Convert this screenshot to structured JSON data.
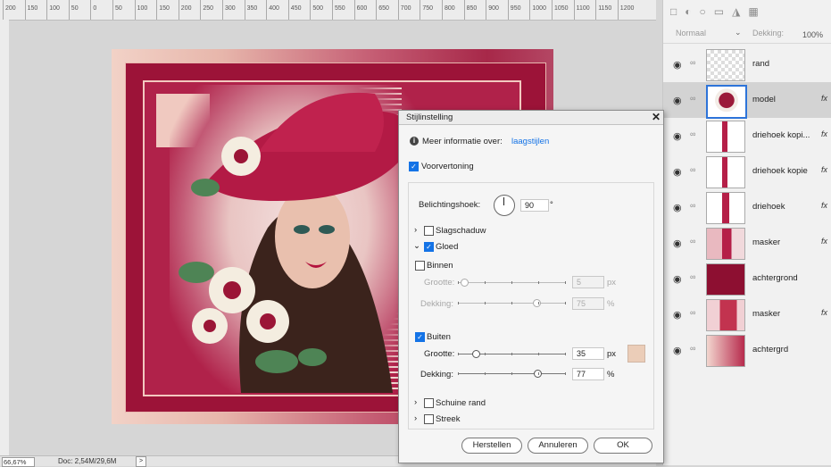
{
  "ruler": {
    "ticks": [
      "200",
      "150",
      "100",
      "50",
      "0",
      "50",
      "100",
      "150",
      "200",
      "250",
      "300",
      "350",
      "400",
      "450",
      "500",
      "550",
      "600",
      "650",
      "700",
      "750",
      "800",
      "850",
      "900",
      "950",
      "1000",
      "1050",
      "1100",
      "1150",
      "1200"
    ]
  },
  "status": {
    "zoom": "66,67%",
    "doc": "Doc: 2,54M/29,6M",
    "arrow": ">"
  },
  "layers_panel": {
    "blend_mode": "Normaal",
    "opacity_label": "Dekking:",
    "opacity_value": "100%",
    "layers": [
      {
        "name": "rand",
        "fx": "",
        "selected": false
      },
      {
        "name": "model",
        "fx": "fx",
        "selected": true
      },
      {
        "name": "driehoek kopi...",
        "fx": "fx",
        "selected": false
      },
      {
        "name": "driehoek kopie",
        "fx": "fx",
        "selected": false
      },
      {
        "name": "driehoek",
        "fx": "fx",
        "selected": false
      },
      {
        "name": "masker",
        "fx": "fx",
        "selected": false
      },
      {
        "name": "achtergrond",
        "fx": "",
        "selected": false
      },
      {
        "name": "masker",
        "fx": "fx",
        "selected": false
      },
      {
        "name": "achtergrd",
        "fx": "",
        "selected": false
      }
    ]
  },
  "dialog": {
    "title": "Stijlinstelling",
    "close": "✕",
    "info_label": "Meer informatie over:",
    "info_link": "laagstijlen",
    "preview": "Voorvertoning",
    "angle_label": "Belichtingshoek:",
    "angle_value": "90",
    "angle_unit": "°",
    "drop_shadow": "Slagschaduw",
    "glow": "Gloed",
    "inner": "Binnen",
    "inner_size_label": "Grootte:",
    "inner_size_value": "5",
    "inner_size_unit": "px",
    "inner_opacity_label": "Dekking:",
    "inner_opacity_value": "75",
    "inner_opacity_unit": "%",
    "outer": "Buiten",
    "outer_size_label": "Grootte:",
    "outer_size_value": "35",
    "outer_size_unit": "px",
    "outer_opacity_label": "Dekking:",
    "outer_opacity_value": "77",
    "outer_opacity_unit": "%",
    "bevel": "Schuine rand",
    "stroke": "Streek",
    "reset": "Herstellen",
    "cancel": "Annuleren",
    "ok": "OK",
    "glow_color": "#ebcdb8"
  }
}
